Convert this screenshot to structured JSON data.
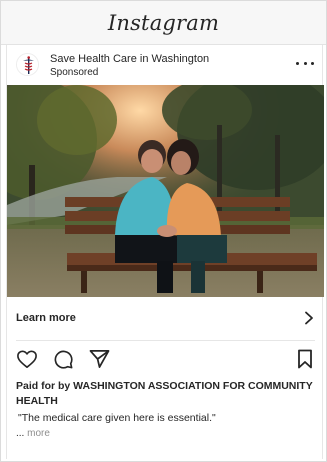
{
  "app": {
    "title": "Instagram"
  },
  "post": {
    "account_name": "Save Health Care in Washington",
    "sponsored_label": "Sponsored",
    "more_options_icon": "more-horizontal-icon",
    "cta_label": "Learn more",
    "cta_icon": "chevron-right-icon",
    "actions": [
      "heart-icon",
      "comment-icon",
      "share-icon",
      "bookmark-icon"
    ],
    "paid_for": "Paid for by WASHINGTON ASSOCIATION FOR COMMUNITY HEALTH",
    "caption": "\"The medical care given here is essential.\"",
    "ellipsis": "...",
    "more_label": "more"
  },
  "colors": {
    "text": "#262626",
    "muted": "#8e8e8e",
    "divider": "#e6e6e6",
    "header_bg": "#f7f7f7"
  }
}
